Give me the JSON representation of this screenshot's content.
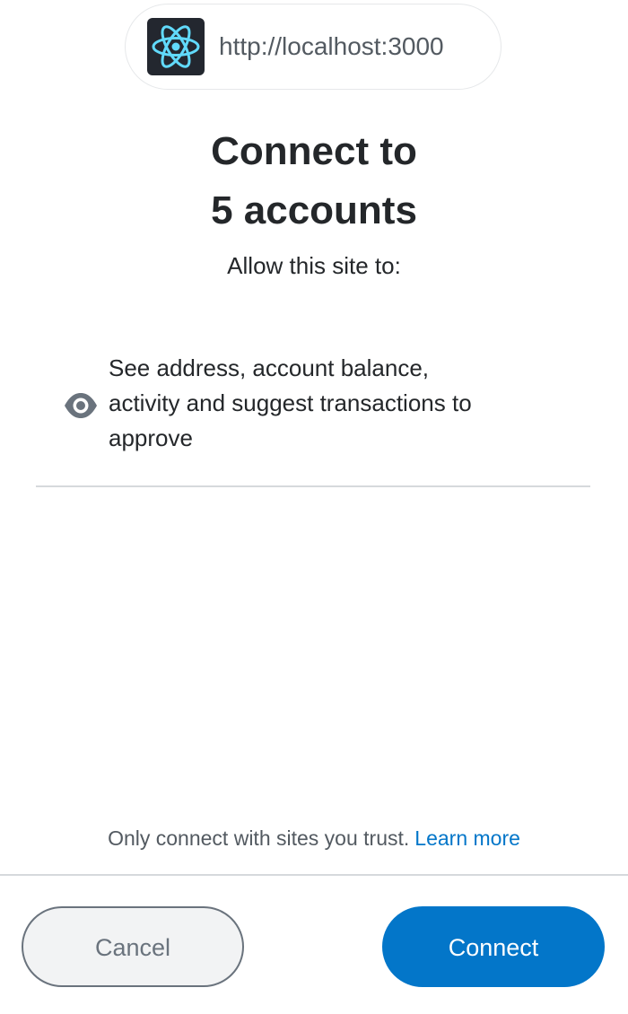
{
  "site": {
    "url": "http://localhost:3000",
    "icon": "react-logo-icon"
  },
  "title": {
    "line1": "Connect to",
    "line2": "5 accounts"
  },
  "subtitle": "Allow this site to:",
  "permissions": [
    {
      "icon": "eye-icon",
      "line1": "See address, account balance,",
      "line2": "activity and suggest transactions to",
      "line3": "approve"
    }
  ],
  "footer": {
    "trust_text": "Only connect with sites you trust.",
    "learn_more": "Learn more"
  },
  "buttons": {
    "cancel": "Cancel",
    "connect": "Connect"
  },
  "colors": {
    "primary": "#0376c9",
    "react": "#61dafb",
    "icon_bg": "#23272f"
  }
}
